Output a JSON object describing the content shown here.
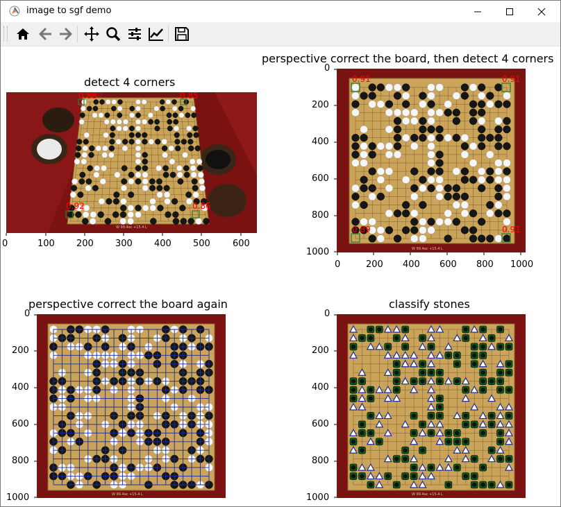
{
  "window": {
    "title": "image to sgf demo"
  },
  "toolbar": {
    "buttons": [
      {
        "name": "home",
        "icon": "home-icon"
      },
      {
        "name": "back",
        "icon": "arrow-left-icon"
      },
      {
        "name": "forward",
        "icon": "arrow-right-icon"
      },
      {
        "name": "pan",
        "icon": "move-icon"
      },
      {
        "name": "zoom",
        "icon": "magnifier-icon"
      },
      {
        "name": "subplots",
        "icon": "sliders-icon"
      },
      {
        "name": "edit-axes",
        "icon": "chart-icon"
      },
      {
        "name": "save",
        "icon": "floppy-disk-icon"
      }
    ]
  },
  "plots": {
    "p1": {
      "title": "detect 4 corners",
      "xticks": [
        "0",
        "100",
        "200",
        "300",
        "400",
        "500",
        "600"
      ],
      "scores": [
        "0.88",
        "0.85",
        "0.92",
        "0.86"
      ]
    },
    "p2": {
      "title": "perspective correct the board, then detect 4 corners",
      "xticks": [
        "0",
        "200",
        "400",
        "600",
        "800",
        "1000"
      ],
      "yticks": [
        "0",
        "200",
        "400",
        "600",
        "800",
        "1000"
      ],
      "scores": [
        "0.91",
        "0.91",
        "0.89",
        "0.91"
      ]
    },
    "p3": {
      "title": "perspective correct the board again",
      "yticks": [
        "0",
        "200",
        "400",
        "600",
        "800",
        "1000"
      ]
    },
    "p4": {
      "title": "classify stones",
      "yticks": [
        "0",
        "200",
        "400",
        "600",
        "800",
        "1000"
      ]
    }
  },
  "colors": {
    "board": "#c9a45a",
    "felt": "#8a1515",
    "corner_box": "#2e7d32",
    "score": "#ff0000",
    "grid_overlay": "#1f2a9c",
    "black_stone_marker": "#0b5d1e",
    "white_stone_marker": "#1f2a9c"
  }
}
